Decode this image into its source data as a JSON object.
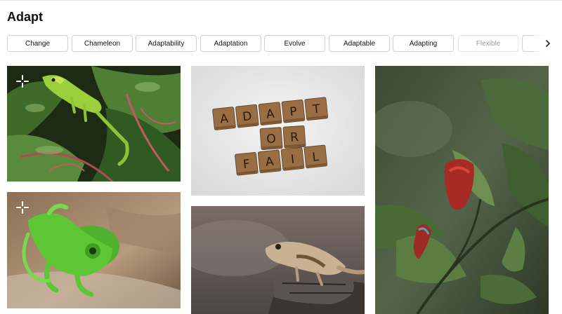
{
  "page": {
    "title": "Adapt"
  },
  "chips": [
    {
      "label": "Change",
      "faded": false
    },
    {
      "label": "Chameleon",
      "faded": false
    },
    {
      "label": "Adaptability",
      "faded": false
    },
    {
      "label": "Adaptation",
      "faded": false
    },
    {
      "label": "Evolve",
      "faded": false
    },
    {
      "label": "Adaptable",
      "faded": false
    },
    {
      "label": "Adapting",
      "faded": false
    },
    {
      "label": "Flexible",
      "faded": true
    }
  ],
  "tiles": {
    "scrabble": {
      "lines": [
        "ADAPT",
        "OR",
        "FAIL"
      ]
    }
  },
  "icons": {
    "next": "chevron-right-icon",
    "badge": "sparkle-icon"
  },
  "colors": {
    "chip_border": "#d1d1d1",
    "chip_faded_text": "#9a9a9a"
  }
}
